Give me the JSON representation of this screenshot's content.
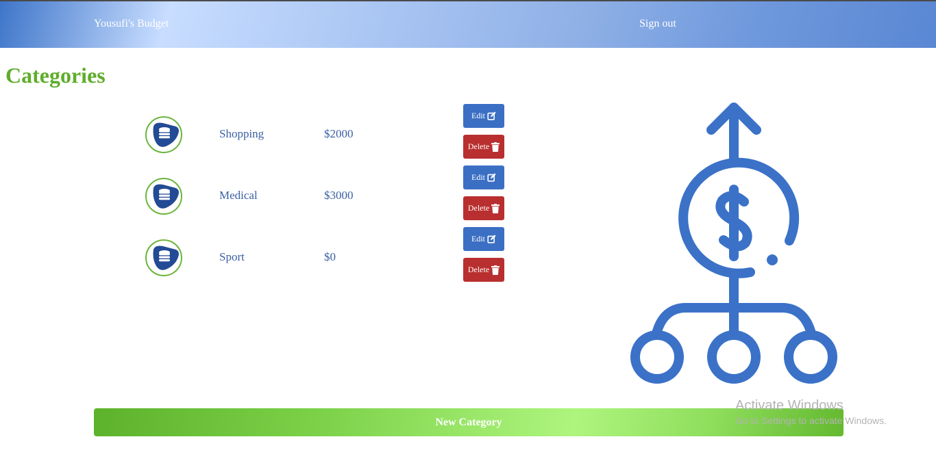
{
  "navbar": {
    "brand": "Yousufi's Budget",
    "sign_out": "Sign out"
  },
  "page": {
    "title": "Categories"
  },
  "categories": [
    {
      "name": "Shopping",
      "amount": "$2000"
    },
    {
      "name": "Medical",
      "amount": "$3000"
    },
    {
      "name": "Sport",
      "amount": "$0"
    }
  ],
  "actions": {
    "edit_label": "Edit",
    "delete_label": "Delete"
  },
  "icons": {
    "category": "coin-stack-icon",
    "edit": "pencil-square-icon",
    "delete": "trash-icon",
    "illustration": "budget-distribution-icon"
  },
  "footer": {
    "new_category": "New Category"
  },
  "watermark": {
    "title": "Activate Windows",
    "subtitle": "Go to Settings to activate Windows."
  },
  "colors": {
    "brand_green": "#5fad2b",
    "accent_blue": "#3b6fc4",
    "danger_red": "#b92f2f",
    "text_blue": "#3a5fa3"
  }
}
